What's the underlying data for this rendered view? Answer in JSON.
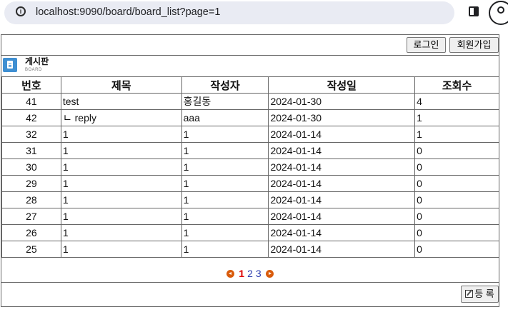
{
  "browser": {
    "url": "localhost:9090/board/board_list?page=1"
  },
  "auth": {
    "login_label": "로그인",
    "join_label": "회원가입"
  },
  "board": {
    "title": "게시판",
    "subtitle": "BOARD"
  },
  "table": {
    "headers": [
      "번호",
      "제목",
      "작성자",
      "작성일",
      "조회수"
    ],
    "rows": [
      {
        "no": "41",
        "title": "test",
        "writer": "홍길동",
        "date": "2024-01-30",
        "views": "4"
      },
      {
        "no": "42",
        "title": "ㄴ reply",
        "writer": "aaa",
        "date": "2024-01-30",
        "views": "1"
      },
      {
        "no": "32",
        "title": "1",
        "writer": "1",
        "date": "2024-01-14",
        "views": "1"
      },
      {
        "no": "31",
        "title": "1",
        "writer": "1",
        "date": "2024-01-14",
        "views": "0"
      },
      {
        "no": "30",
        "title": "1",
        "writer": "1",
        "date": "2024-01-14",
        "views": "0"
      },
      {
        "no": "29",
        "title": "1",
        "writer": "1",
        "date": "2024-01-14",
        "views": "0"
      },
      {
        "no": "28",
        "title": "1",
        "writer": "1",
        "date": "2024-01-14",
        "views": "0"
      },
      {
        "no": "27",
        "title": "1",
        "writer": "1",
        "date": "2024-01-14",
        "views": "0"
      },
      {
        "no": "26",
        "title": "1",
        "writer": "1",
        "date": "2024-01-14",
        "views": "0"
      },
      {
        "no": "25",
        "title": "1",
        "writer": "1",
        "date": "2024-01-14",
        "views": "0"
      }
    ]
  },
  "pagination": {
    "pages": [
      "1",
      "2",
      "3"
    ],
    "current": "1"
  },
  "actions": {
    "register_label": "등 록"
  },
  "colors": {
    "pager_arrow": "#d95b0b",
    "current_page": "#dd0000",
    "page_link": "#2f3fb0",
    "board_icon": "#3f8fd2"
  }
}
